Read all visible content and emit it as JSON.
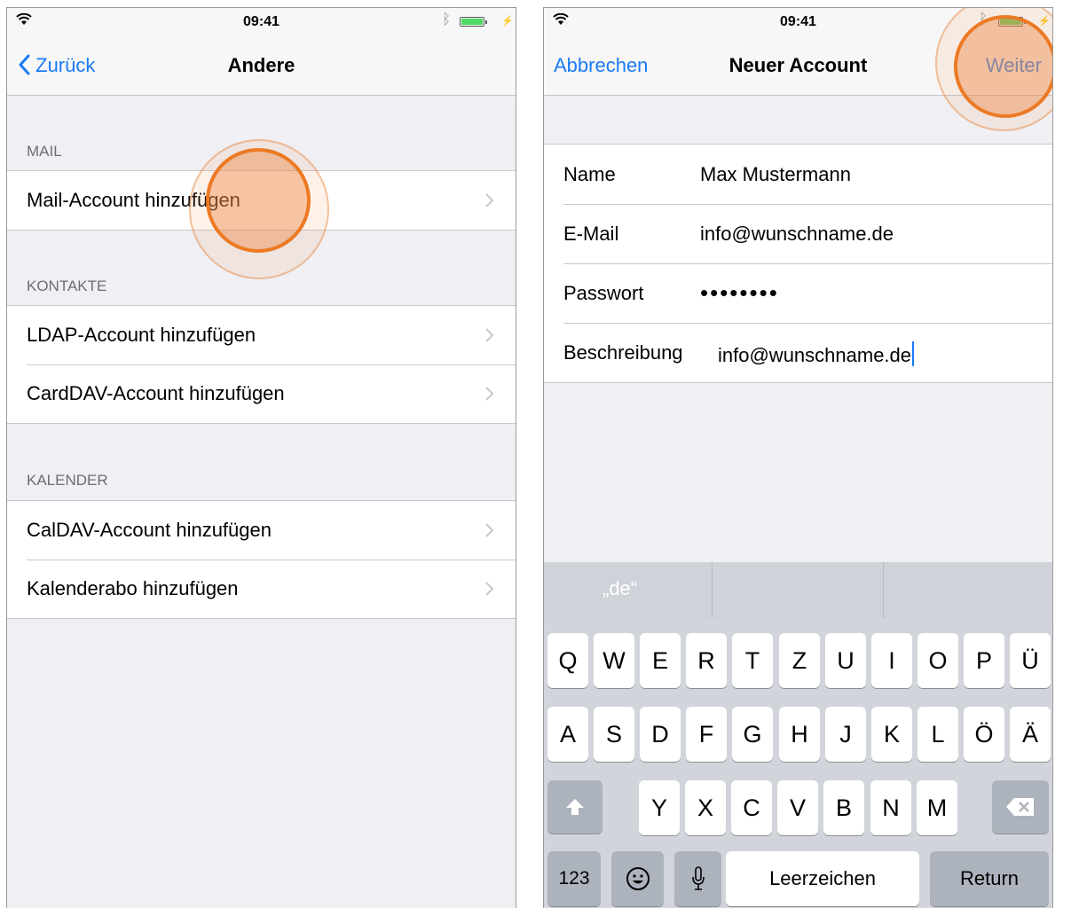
{
  "left": {
    "status": {
      "time": "09:41"
    },
    "nav": {
      "back_label": "Zurück",
      "title": "Andere"
    },
    "sections": [
      {
        "header": "MAIL",
        "items": [
          "Mail-Account hinzufügen"
        ]
      },
      {
        "header": "KONTAKTE",
        "items": [
          "LDAP-Account hinzufügen",
          "CardDAV-Account hinzufügen"
        ]
      },
      {
        "header": "KALENDER",
        "items": [
          "CalDAV-Account hinzufügen",
          "Kalenderabo hinzufügen"
        ]
      }
    ]
  },
  "right": {
    "status": {
      "time": "09:41"
    },
    "nav": {
      "cancel_label": "Abbrechen",
      "title": "Neuer Account",
      "next_label": "Weiter"
    },
    "form": {
      "name_label": "Name",
      "name_value": "Max Mustermann",
      "email_label": "E-Mail",
      "email_value": "info@wunschname.de",
      "password_label": "Passwort",
      "password_value": "••••••••",
      "description_label": "Beschreibung",
      "description_value": "info@wunschname.de"
    },
    "suggestions": [
      "„de“",
      "",
      ""
    ],
    "keyboard": {
      "row1": [
        "Q",
        "W",
        "E",
        "R",
        "T",
        "Z",
        "U",
        "I",
        "O",
        "P",
        "Ü"
      ],
      "row2": [
        "A",
        "S",
        "D",
        "F",
        "G",
        "H",
        "J",
        "K",
        "L",
        "Ö",
        "Ä"
      ],
      "row3": [
        "Y",
        "X",
        "C",
        "V",
        "B",
        "N",
        "M"
      ],
      "numbers_label": "123",
      "space_label": "Leerzeichen",
      "return_label": "Return"
    }
  },
  "colors": {
    "accent": "#1a7bf6",
    "highlight": "#ec7a24",
    "battery": "#4cd964"
  },
  "icons": [
    "wifi-icon",
    "bluetooth-icon",
    "battery-icon",
    "back-chevron-icon",
    "chevron-right-icon",
    "shift-icon",
    "backspace-icon",
    "emoji-icon",
    "microphone-icon"
  ]
}
